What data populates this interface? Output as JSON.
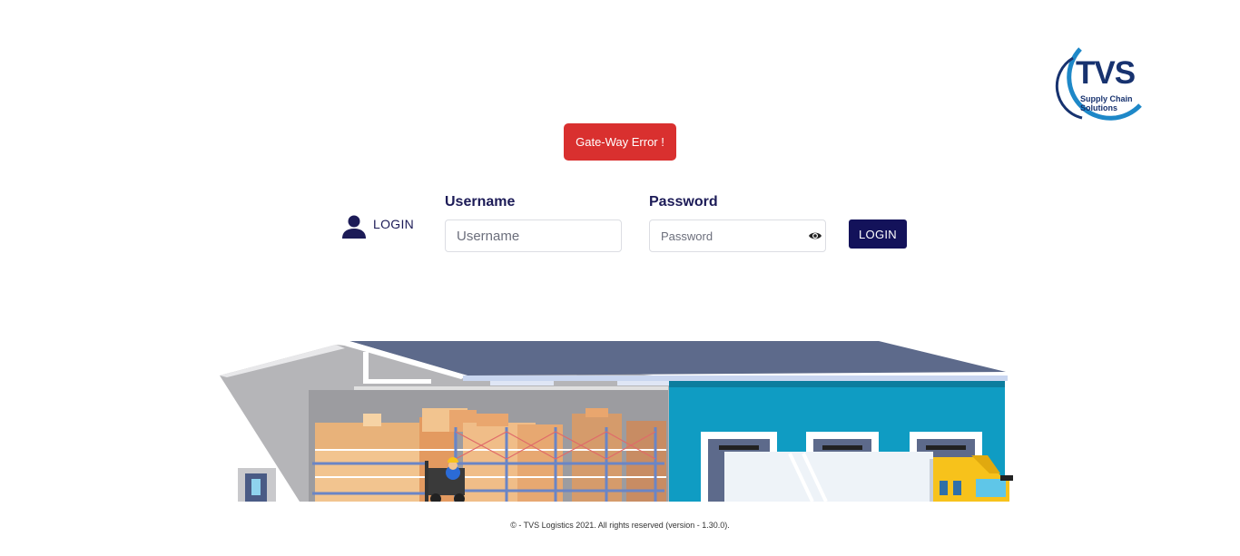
{
  "logo": {
    "brand": "TVS",
    "tagline_line1": "Supply Chain",
    "tagline_line2": "Solutions"
  },
  "error": {
    "message": "Gate-Way Error !"
  },
  "login": {
    "heading": "LOGIN",
    "icon": "user-icon",
    "username_label": "Username",
    "username_placeholder": "Username",
    "username_value": "",
    "password_label": "Password",
    "password_placeholder": "Password",
    "password_value": "",
    "password_toggle_icon": "eye-icon",
    "submit_label": "LOGIN"
  },
  "colors": {
    "primary": "#13125a",
    "error": "#d9302f",
    "warehouse_roof": "#5d6a8b",
    "warehouse_wall": "#0f9cc3",
    "truck": "#f7c21b"
  },
  "footer": {
    "text": "© - TVS Logistics 2021. All rights reserved (version - 1.30.0)."
  }
}
